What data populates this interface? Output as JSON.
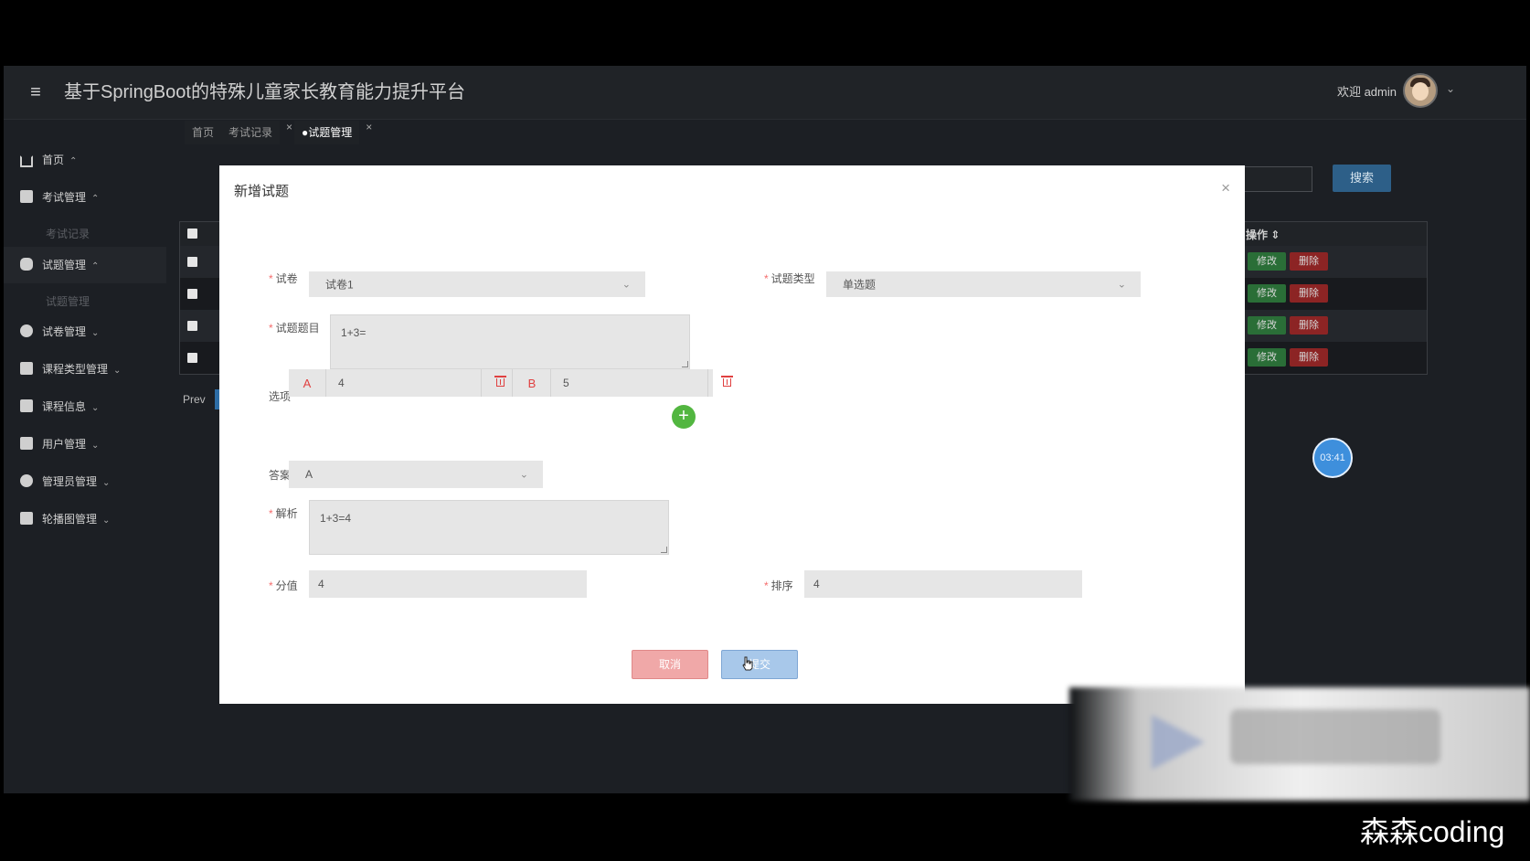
{
  "app": {
    "title": "基于SpringBoot的特殊儿童家长教育能力提升平台",
    "welcome": "欢迎 admin"
  },
  "sidebar": {
    "items": [
      {
        "label": "首页",
        "icon": "home-icon"
      },
      {
        "label": "考试管理",
        "icon": "exam-icon"
      },
      {
        "label": "考试记录",
        "sub": true
      },
      {
        "label": "试题管理",
        "icon": "question-icon"
      },
      {
        "label": "试题管理",
        "sub": true
      },
      {
        "label": "试卷管理",
        "icon": "paper-icon"
      },
      {
        "label": "课程类型管理",
        "icon": "briefcase-icon"
      },
      {
        "label": "课程信息",
        "icon": "book-icon"
      },
      {
        "label": "用户管理",
        "icon": "user-icon"
      },
      {
        "label": "管理员管理",
        "icon": "admin-icon"
      },
      {
        "label": "轮播图管理",
        "icon": "carousel-icon"
      }
    ]
  },
  "tabs": [
    {
      "label": "首页"
    },
    {
      "label": "考试记录"
    },
    {
      "label": "●试题管理",
      "active": true
    }
  ],
  "toolbar": {
    "search_label": "搜索"
  },
  "table": {
    "header_op": "操作 ⇕",
    "row_actions": {
      "edit": "修改",
      "delete": "删除"
    },
    "row_count": 4
  },
  "pager": {
    "prev": "Prev"
  },
  "timer": "03:41",
  "modal": {
    "title": "新增试题",
    "close": "×",
    "paper_label": "试卷",
    "paper_value": "试卷1",
    "type_label": "试题类型",
    "type_value": "单选题",
    "question_label": "试题题目",
    "question_value": "1+3=",
    "options_label": "选项",
    "options": [
      {
        "letter": "A",
        "value": "4"
      },
      {
        "letter": "B",
        "value": "5"
      }
    ],
    "answer_label": "答案",
    "answer_value": "A",
    "analysis_label": "解析",
    "analysis_value": "1+3=4",
    "score_label": "分值",
    "score_value": "4",
    "order_label": "排序",
    "order_value": "4",
    "cancel": "取消",
    "submit": "提交"
  },
  "credit": "森森coding",
  "colors": {
    "danger": "#e04040",
    "success": "#52b640",
    "primary": "#3e8fdc"
  }
}
